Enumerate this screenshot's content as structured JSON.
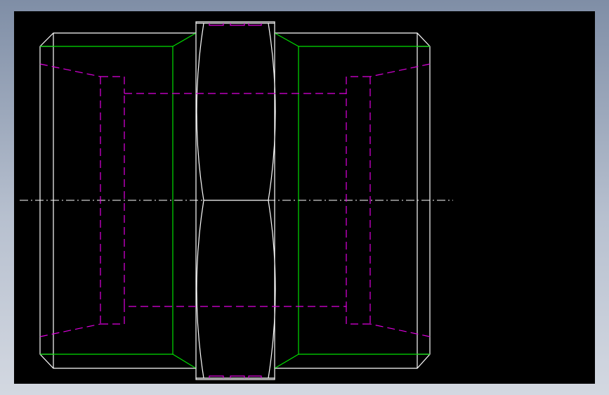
{
  "background": {
    "window_gradient_top": "#7f8ea6",
    "window_gradient_bottom": "#d3d8e1",
    "viewport": "#000000"
  },
  "colors": {
    "outline": "#ffffff",
    "thread_line": "#00e000",
    "hidden_line": "#e000e0",
    "centerline": "#ffffff"
  },
  "drawing": {
    "kind": "pipe coupling / nipple section view",
    "line_styles": [
      "solid",
      "dashed",
      "dash-dot"
    ]
  }
}
